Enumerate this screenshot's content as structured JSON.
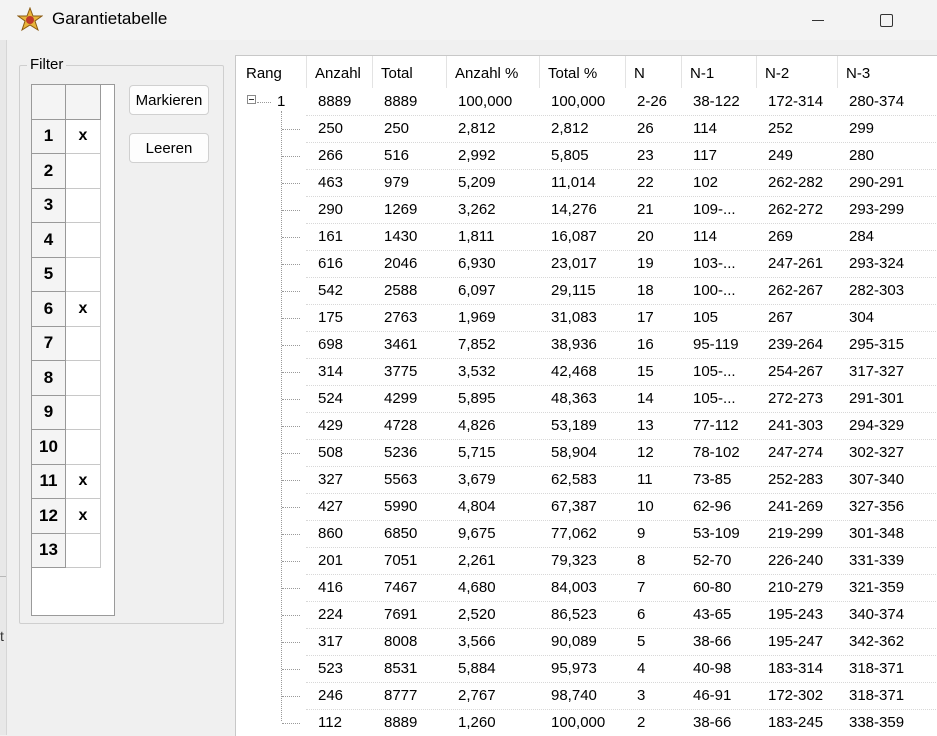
{
  "window": {
    "title": "Garantietabelle"
  },
  "filter": {
    "legend": "Filter",
    "rows": [
      {
        "num": "1",
        "mark": "x"
      },
      {
        "num": "2",
        "mark": ""
      },
      {
        "num": "3",
        "mark": ""
      },
      {
        "num": "4",
        "mark": ""
      },
      {
        "num": "5",
        "mark": ""
      },
      {
        "num": "6",
        "mark": "x"
      },
      {
        "num": "7",
        "mark": ""
      },
      {
        "num": "8",
        "mark": ""
      },
      {
        "num": "9",
        "mark": ""
      },
      {
        "num": "10",
        "mark": ""
      },
      {
        "num": "11",
        "mark": "x"
      },
      {
        "num": "12",
        "mark": "x"
      },
      {
        "num": "13",
        "mark": ""
      }
    ],
    "mark_button": "Markieren",
    "clear_button": "Leeren"
  },
  "table": {
    "columns": [
      "Rang",
      "Anzahl",
      "Total",
      "Anzahl %",
      "Total %",
      "N",
      "N-1",
      "N-2",
      "N-3"
    ],
    "root": {
      "rang": "1",
      "cells": [
        "8889",
        "8889",
        "100,000",
        "100,000",
        "2-26",
        "38-122",
        "172-314",
        "280-374"
      ]
    },
    "rows": [
      [
        "250",
        "250",
        "2,812",
        "2,812",
        "26",
        "114",
        "252",
        "299"
      ],
      [
        "266",
        "516",
        "2,992",
        "5,805",
        "23",
        "117",
        "249",
        "280"
      ],
      [
        "463",
        "979",
        "5,209",
        "11,014",
        "22",
        "102",
        "262-282",
        "290-291"
      ],
      [
        "290",
        "1269",
        "3,262",
        "14,276",
        "21",
        "109-...",
        "262-272",
        "293-299"
      ],
      [
        "161",
        "1430",
        "1,811",
        "16,087",
        "20",
        "114",
        "269",
        "284"
      ],
      [
        "616",
        "2046",
        "6,930",
        "23,017",
        "19",
        "103-...",
        "247-261",
        "293-324"
      ],
      [
        "542",
        "2588",
        "6,097",
        "29,115",
        "18",
        "100-...",
        "262-267",
        "282-303"
      ],
      [
        "175",
        "2763",
        "1,969",
        "31,083",
        "17",
        "105",
        "267",
        "304"
      ],
      [
        "698",
        "3461",
        "7,852",
        "38,936",
        "16",
        "95-119",
        "239-264",
        "295-315"
      ],
      [
        "314",
        "3775",
        "3,532",
        "42,468",
        "15",
        "105-...",
        "254-267",
        "317-327"
      ],
      [
        "524",
        "4299",
        "5,895",
        "48,363",
        "14",
        "105-...",
        "272-273",
        "291-301"
      ],
      [
        "429",
        "4728",
        "4,826",
        "53,189",
        "13",
        "77-112",
        "241-303",
        "294-329"
      ],
      [
        "508",
        "5236",
        "5,715",
        "58,904",
        "12",
        "78-102",
        "247-274",
        "302-327"
      ],
      [
        "327",
        "5563",
        "3,679",
        "62,583",
        "11",
        "73-85",
        "252-283",
        "307-340"
      ],
      [
        "427",
        "5990",
        "4,804",
        "67,387",
        "10",
        "62-96",
        "241-269",
        "327-356"
      ],
      [
        "860",
        "6850",
        "9,675",
        "77,062",
        "9",
        "53-109",
        "219-299",
        "301-348"
      ],
      [
        "201",
        "7051",
        "2,261",
        "79,323",
        "8",
        "52-70",
        "226-240",
        "331-339"
      ],
      [
        "416",
        "7467",
        "4,680",
        "84,003",
        "7",
        "60-80",
        "210-279",
        "321-359"
      ],
      [
        "224",
        "7691",
        "2,520",
        "86,523",
        "6",
        "43-65",
        "195-243",
        "340-374"
      ],
      [
        "317",
        "8008",
        "3,566",
        "90,089",
        "5",
        "38-66",
        "195-247",
        "342-362"
      ],
      [
        "523",
        "8531",
        "5,884",
        "95,973",
        "4",
        "40-98",
        "183-314",
        "318-371"
      ],
      [
        "246",
        "8777",
        "2,767",
        "98,740",
        "3",
        "46-91",
        "172-302",
        "318-371"
      ],
      [
        "112",
        "8889",
        "1,260",
        "100,000",
        "2",
        "38-66",
        "183-245",
        "338-359"
      ]
    ]
  },
  "left_edge": {
    "glyph": "t"
  }
}
